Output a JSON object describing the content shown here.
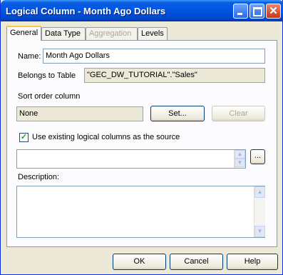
{
  "window": {
    "title": "Logical Column - Month Ago Dollars",
    "minimize_icon": "minimize-icon",
    "maximize_icon": "maximize-icon",
    "close_icon": "close-icon",
    "close_glyph": "✕"
  },
  "tabs": [
    {
      "label": "General",
      "active": true,
      "enabled": true
    },
    {
      "label": "Data Type",
      "active": false,
      "enabled": true
    },
    {
      "label": "Aggregation",
      "active": false,
      "enabled": false
    },
    {
      "label": "Levels",
      "active": false,
      "enabled": true
    }
  ],
  "general": {
    "name_label": "Name:",
    "name_value": "Month Ago Dollars",
    "belongs_label": "Belongs to Table",
    "belongs_value": "\"GEC_DW_TUTORIAL\".\"Sales\"",
    "sort_label": "Sort order column",
    "sort_value": "None",
    "set_button": "Set...",
    "clear_button": "Clear",
    "use_existing_checked": true,
    "use_existing_label": "Use existing logical columns as the source",
    "check_mark": "✓",
    "source_value": "",
    "ellipsis_button": "...",
    "description_label": "Description:",
    "description_value": "",
    "scroll_up": "▲",
    "scroll_down": "▼"
  },
  "footer": {
    "ok": "OK",
    "cancel": "Cancel",
    "help": "Help"
  }
}
